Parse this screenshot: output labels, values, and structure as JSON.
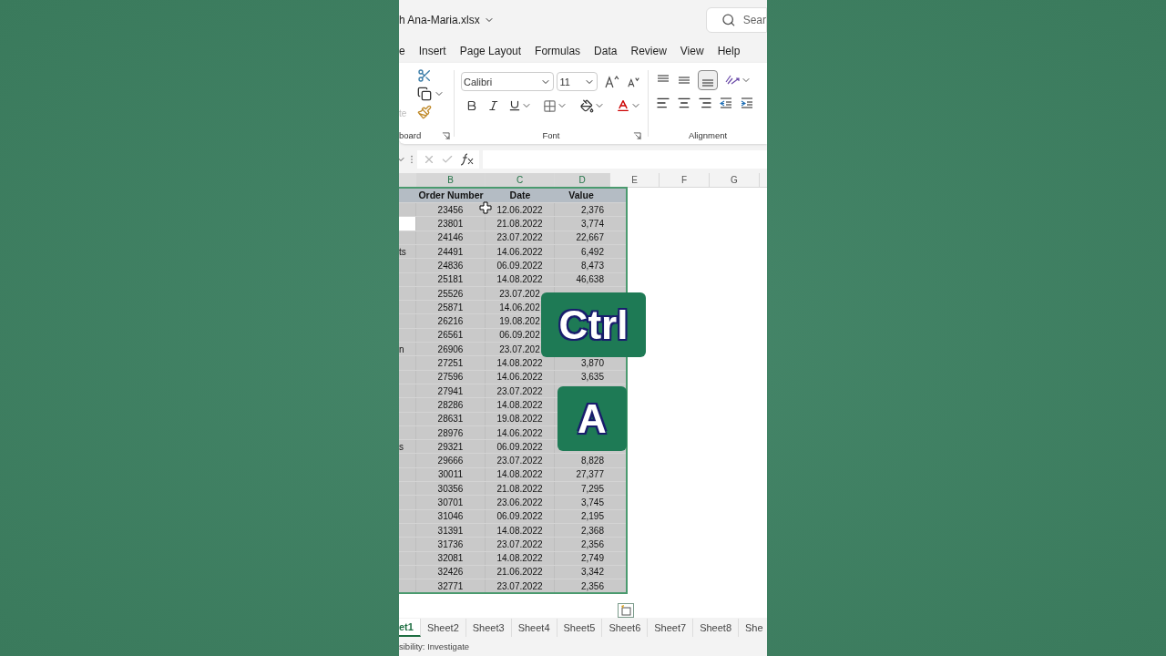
{
  "title_bar": {
    "file_name": "h Ana-Maria.xlsx",
    "search_placeholder": "Sear"
  },
  "menu_tabs": [
    {
      "label": "e",
      "selected": false
    },
    {
      "label": "Insert",
      "selected": false
    },
    {
      "label": "Page Layout",
      "selected": false
    },
    {
      "label": "Formulas",
      "selected": false
    },
    {
      "label": "Data",
      "selected": false
    },
    {
      "label": "Review",
      "selected": false
    },
    {
      "label": "View",
      "selected": false
    },
    {
      "label": "Help",
      "selected": false
    }
  ],
  "ribbon": {
    "paste_label": "te",
    "clipboard_label": "board",
    "font_name": "Calibri",
    "font_size": "11",
    "font_label": "Font",
    "alignment_label": "Alignment"
  },
  "columns": [
    {
      "label": "B",
      "selected": true
    },
    {
      "label": "C",
      "selected": true
    },
    {
      "label": "D",
      "selected": true
    },
    {
      "label": "E",
      "selected": false
    },
    {
      "label": "F",
      "selected": false
    },
    {
      "label": "G",
      "selected": false
    }
  ],
  "header_row": {
    "b": "Order Number",
    "c": "Date",
    "d": "Value"
  },
  "rows": [
    {
      "b": "23456",
      "c": "12.06.2022",
      "d": "2,376",
      "a_active": false
    },
    {
      "b": "23801",
      "c": "21.08.2022",
      "d": "3,774",
      "a_active": true
    },
    {
      "b": "24146",
      "c": "23.07.2022",
      "d": "22,667",
      "a_active": false
    },
    {
      "a": "ts",
      "b": "24491",
      "c": "14.06.2022",
      "d": "6,492",
      "a_active": false
    },
    {
      "b": "24836",
      "c": "06.09.2022",
      "d": "8,473",
      "a_active": false
    },
    {
      "b": "25181",
      "c": "14.08.2022",
      "d": "46,638",
      "a_active": false
    },
    {
      "b": "25526",
      "c": "23.07.202",
      "a_active": false
    },
    {
      "b": "25871",
      "c": "14.06.202",
      "a_active": false
    },
    {
      "b": "26216",
      "c": "19.08.202",
      "a_active": false
    },
    {
      "b": "26561",
      "c": "06.09.202",
      "a_active": false
    },
    {
      "a": "n",
      "b": "26906",
      "c": "23.07.202",
      "a_active": false
    },
    {
      "b": "27251",
      "c": "14.08.2022",
      "d": "3,870",
      "a_active": false
    },
    {
      "b": "27596",
      "c": "14.06.2022",
      "d": "3,635",
      "a_active": false
    },
    {
      "b": "27941",
      "c": "23.07.2022",
      "a_active": false
    },
    {
      "b": "28286",
      "c": "14.08.2022",
      "a_active": false
    },
    {
      "b": "28631",
      "c": "19.08.2022",
      "a_active": false
    },
    {
      "b": "28976",
      "c": "14.06.2022",
      "a_active": false
    },
    {
      "a": "s",
      "b": "29321",
      "c": "06.09.2022",
      "a_active": false
    },
    {
      "b": "29666",
      "c": "23.07.2022",
      "d": "8,828",
      "a_active": false
    },
    {
      "b": "30011",
      "c": "14.08.2022",
      "d": "27,377",
      "a_active": false
    },
    {
      "b": "30356",
      "c": "21.08.2022",
      "d": "7,295",
      "a_active": false
    },
    {
      "b": "30701",
      "c": "23.06.2022",
      "d": "3,745",
      "a_active": false
    },
    {
      "b": "31046",
      "c": "06.09.2022",
      "d": "2,195",
      "a_active": false
    },
    {
      "b": "31391",
      "c": "14.08.2022",
      "d": "2,368",
      "a_active": false
    },
    {
      "b": "31736",
      "c": "23.07.2022",
      "d": "2,356",
      "a_active": false
    },
    {
      "b": "32081",
      "c": "14.08.2022",
      "d": "2,749",
      "a_active": false
    },
    {
      "b": "32426",
      "c": "21.06.2022",
      "d": "3,342",
      "a_active": false
    },
    {
      "b": "32771",
      "c": "23.07.2022",
      "d": "2,356",
      "a_active": false
    }
  ],
  "sheet_tabs": [
    {
      "label": "et1",
      "selected": true
    },
    {
      "label": "Sheet2",
      "selected": false
    },
    {
      "label": "Sheet3",
      "selected": false
    },
    {
      "label": "Sheet4",
      "selected": false
    },
    {
      "label": "Sheet5",
      "selected": false
    },
    {
      "label": "Sheet6",
      "selected": false
    },
    {
      "label": "Sheet7",
      "selected": false
    },
    {
      "label": "Sheet8",
      "selected": false
    },
    {
      "label": "She",
      "selected": false
    }
  ],
  "status_bar": {
    "text": "sibility: Investigate"
  },
  "key_overlays": [
    {
      "label": "Ctrl"
    },
    {
      "label": "A"
    }
  ]
}
